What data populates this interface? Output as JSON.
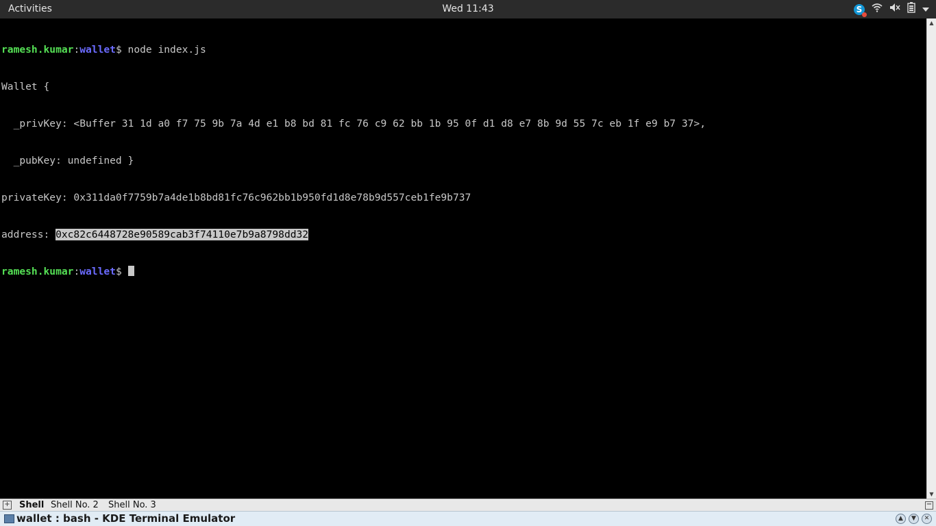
{
  "topbar": {
    "activities": "Activities",
    "clock": "Wed 11:43",
    "tray_icons": [
      "skype-icon",
      "wifi-icon",
      "volume-muted-icon",
      "battery-icon",
      "dropdown-arrow-icon"
    ]
  },
  "terminal": {
    "prompt_user": "ramesh.kumar",
    "prompt_sep": ":",
    "prompt_dir": "wallet",
    "prompt_symbol": "$ ",
    "command": "node index.js",
    "output": {
      "line1": "Wallet {",
      "line2": "  _privKey: <Buffer 31 1d a0 f7 75 9b 7a 4d e1 b8 bd 81 fc 76 c9 62 bb 1b 95 0f d1 d8 e7 8b 9d 55 7c eb 1f e9 b7 37>,",
      "line3": "  _pubKey: undefined }",
      "line4": "privateKey: 0x311da0f7759b7a4de1b8bd81fc76c962bb1b950fd1d8e78b9d557ceb1fe9b737",
      "address_label": "address: ",
      "address_value": "0xc82c6448728e90589cab3f74110e7b9a8798dd32"
    },
    "colors": {
      "user": "#55e055",
      "dir": "#6b6bff",
      "text": "#c8c8c8",
      "background": "#000000"
    }
  },
  "tabs": {
    "items": [
      "Shell",
      "Shell No. 2",
      "Shell No. 3"
    ],
    "active": "Shell"
  },
  "window": {
    "title": "wallet : bash - KDE Terminal Emulator"
  }
}
